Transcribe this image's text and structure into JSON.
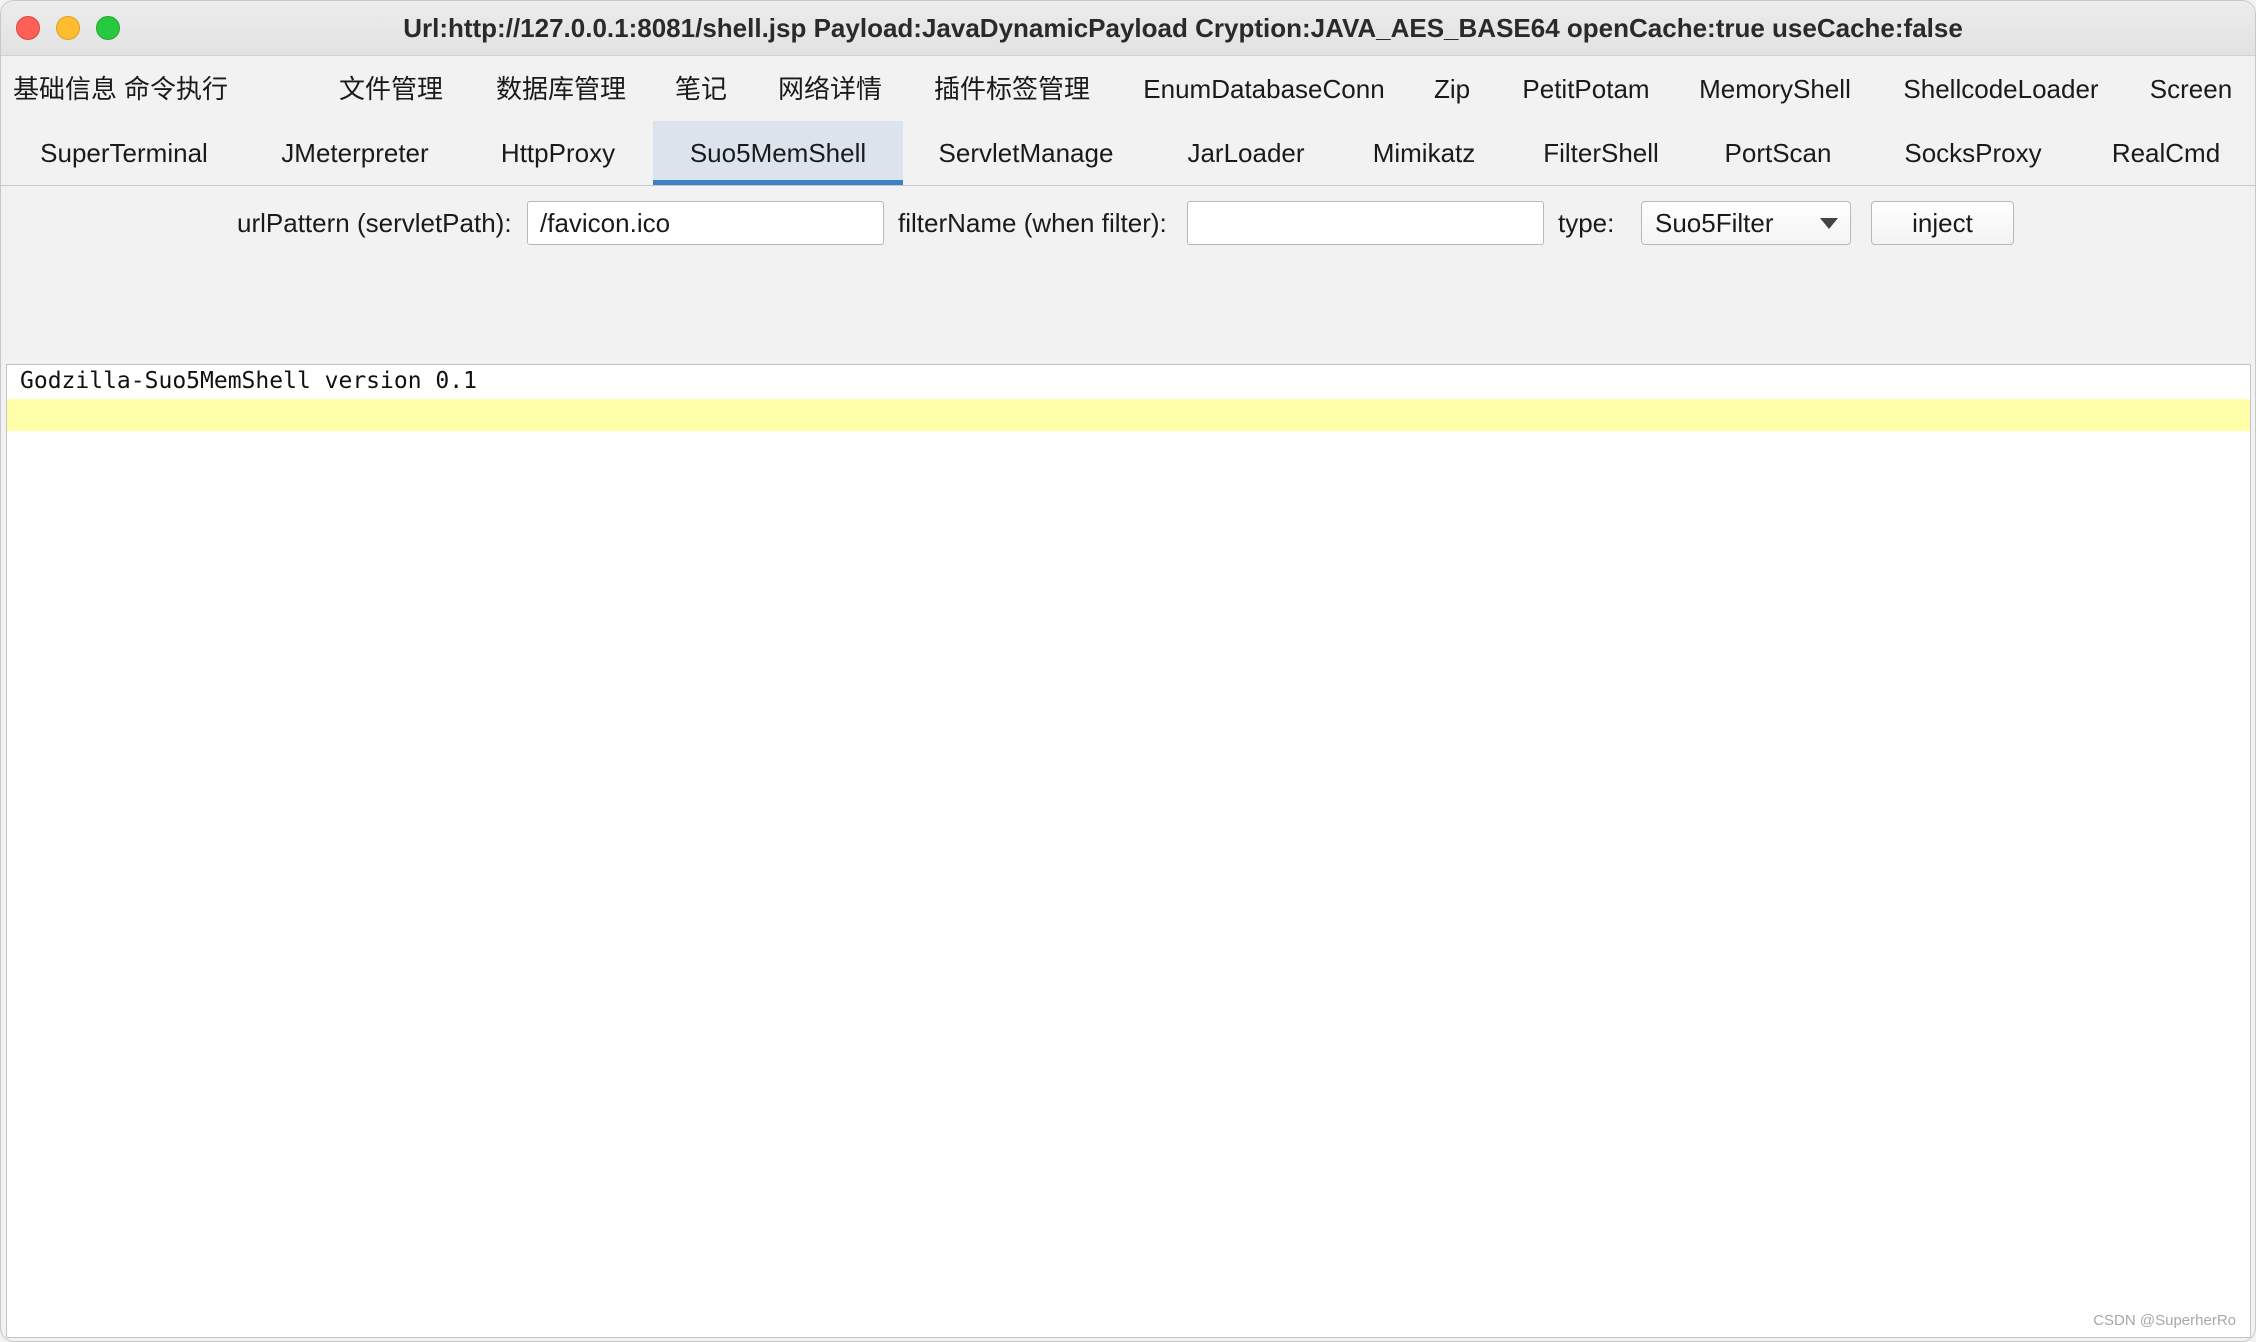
{
  "window": {
    "title": "Url:http://127.0.0.1:8081/shell.jsp Payload:JavaDynamicPayload Cryption:JAVA_AES_BASE64 openCache:true useCache:false"
  },
  "tabs_row1": [
    {
      "label": "基础信息"
    },
    {
      "label": "命令执行"
    },
    {
      "label": "文件管理"
    },
    {
      "label": "数据库管理"
    },
    {
      "label": "笔记"
    },
    {
      "label": "网络详情"
    },
    {
      "label": "插件标签管理"
    },
    {
      "label": "EnumDatabaseConn"
    },
    {
      "label": "Zip"
    },
    {
      "label": "PetitPotam"
    },
    {
      "label": "MemoryShell"
    },
    {
      "label": "ShellcodeLoader"
    },
    {
      "label": "Screen"
    }
  ],
  "tabs_row2": [
    {
      "label": "SuperTerminal"
    },
    {
      "label": "JMeterpreter"
    },
    {
      "label": "HttpProxy"
    },
    {
      "label": "Suo5MemShell",
      "active": true
    },
    {
      "label": "ServletManage"
    },
    {
      "label": "JarLoader"
    },
    {
      "label": "Mimikatz"
    },
    {
      "label": "FilterShell"
    },
    {
      "label": "PortScan"
    },
    {
      "label": "SocksProxy"
    },
    {
      "label": "RealCmd"
    }
  ],
  "form": {
    "url_pattern_label": "urlPattern (servletPath):",
    "url_pattern_value": "/favicon.ico",
    "filter_name_label": "filterName (when filter):",
    "filter_name_value": "",
    "type_label": "type:",
    "type_selected": "Suo5Filter",
    "inject_label": "inject"
  },
  "console": {
    "lines": [
      "Godzilla-Suo5MemShell version 0.1"
    ]
  },
  "watermark": "CSDN @SuperherRo",
  "colors": {
    "active_tab_bg": "#dbe4ec",
    "active_tab_underline": "#3f7fc6",
    "current_line_highlight": "#ffffa8"
  }
}
